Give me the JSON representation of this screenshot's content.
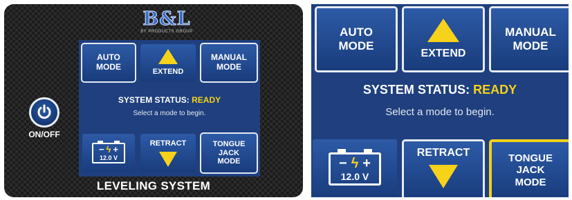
{
  "brand": {
    "logo_text": "B&L",
    "logo_subtext": "BY PRODUCTS GROUP"
  },
  "power": {
    "label": "ON/OFF"
  },
  "buttons": {
    "auto_line1": "AUTO",
    "auto_line2": "MODE",
    "extend": "EXTEND",
    "manual_line1": "MANUAL",
    "manual_line2": "MODE",
    "retract": "RETRACT",
    "tongue_line1": "TONGUE",
    "tongue_line2": "JACK",
    "tongue_line3": "MODE"
  },
  "status": {
    "label": "SYSTEM STATUS:",
    "value": "READY",
    "hint": "Select a mode to begin."
  },
  "battery": {
    "minus": "−",
    "plus": "+",
    "voltage": "12.0 V"
  },
  "footer": {
    "title": "LEVELING SYSTEM"
  },
  "colors": {
    "panel_blue": "#1f3f7e",
    "button_blue": "#2d5aa6",
    "accent_yellow": "#f6d21a",
    "selected_border": "#f2d11a"
  }
}
